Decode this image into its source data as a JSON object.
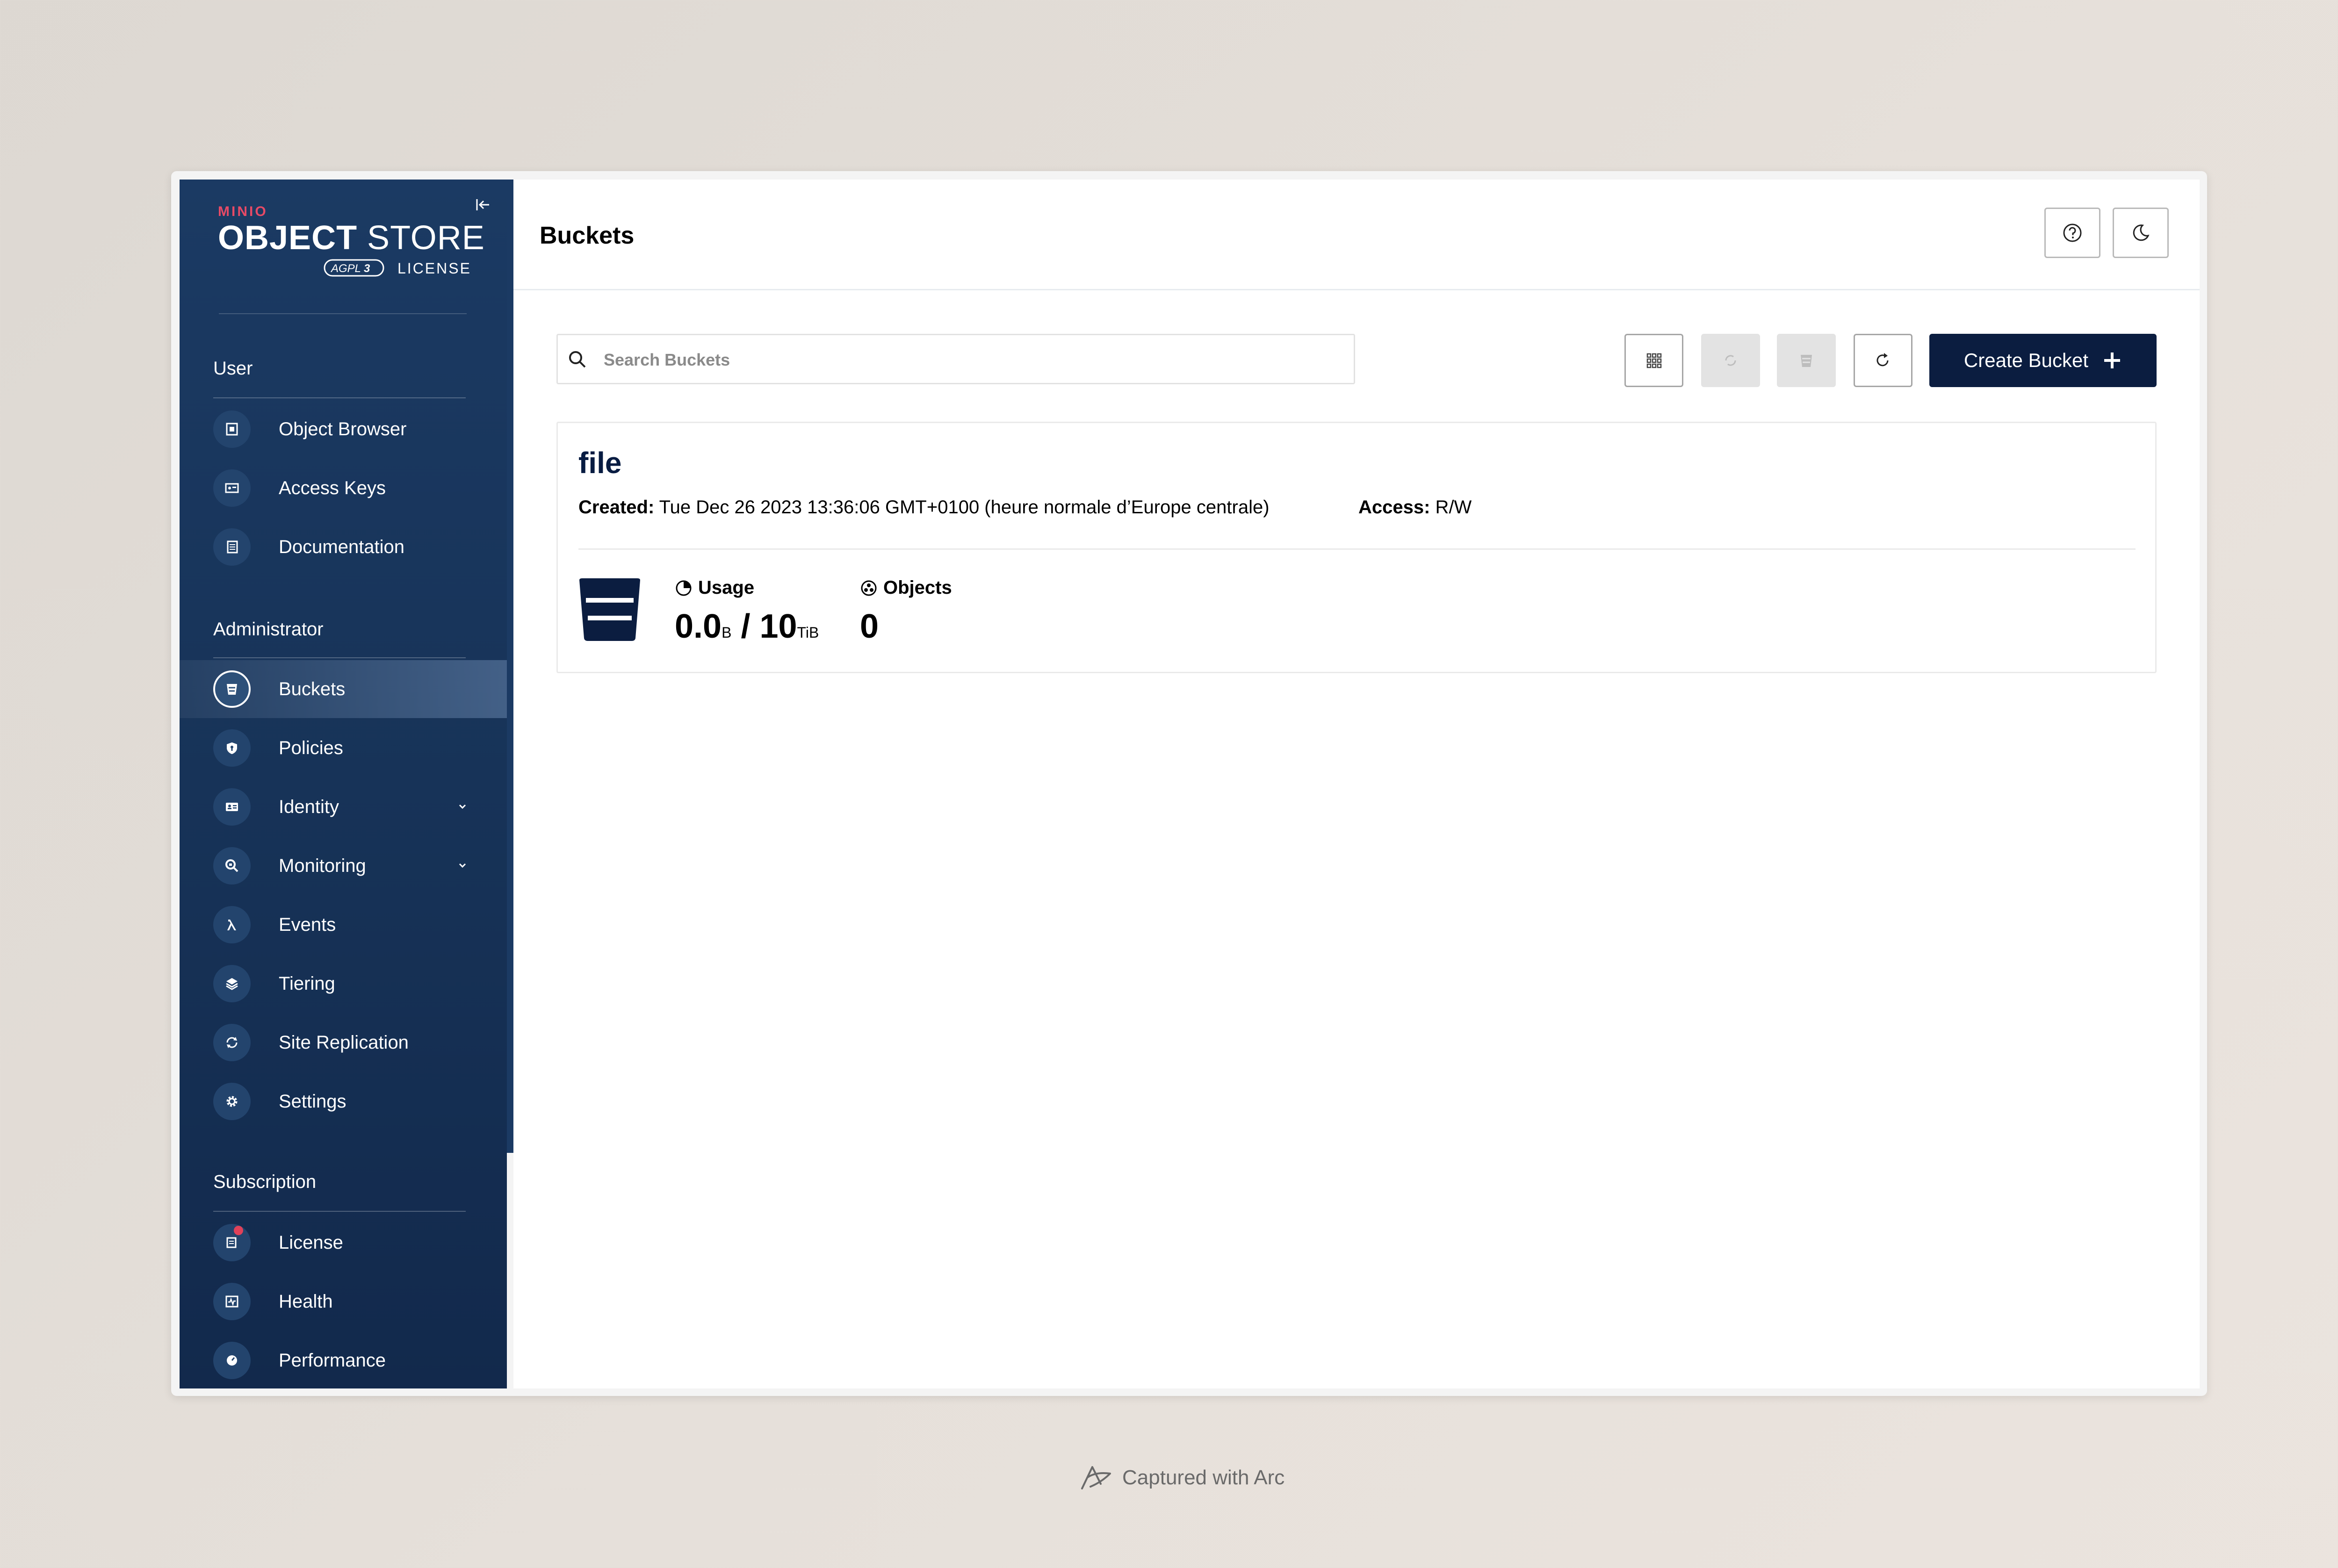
{
  "sidebar": {
    "logo": {
      "brand": "MINIO",
      "product_bold": "OBJECT",
      "product_light": " STORE",
      "badge": "AGPLv3",
      "license": "LICENSE"
    },
    "sections": [
      {
        "title": "User"
      },
      {
        "title": "Administrator"
      },
      {
        "title": "Subscription"
      }
    ],
    "items": [
      {
        "label": "Object Browser"
      },
      {
        "label": "Access Keys"
      },
      {
        "label": "Documentation"
      },
      {
        "label": "Buckets"
      },
      {
        "label": "Policies"
      },
      {
        "label": "Identity"
      },
      {
        "label": "Monitoring"
      },
      {
        "label": "Events"
      },
      {
        "label": "Tiering"
      },
      {
        "label": "Site Replication"
      },
      {
        "label": "Settings"
      },
      {
        "label": "License"
      },
      {
        "label": "Health"
      },
      {
        "label": "Performance"
      }
    ],
    "active_item": "Buckets"
  },
  "header": {
    "title": "Buckets"
  },
  "toolbar": {
    "search_placeholder": "Search Buckets",
    "create_label": "Create Bucket"
  },
  "bucket": {
    "name": "file",
    "created_label": "Created:",
    "created_value": " Tue Dec 26 2023 13:36:06 GMT+0100 (heure normale d’Europe centrale)",
    "access_label": "Access:",
    "access_value": " R/W",
    "usage_label": "Usage",
    "usage_used": "0.0",
    "usage_used_unit": "B",
    "usage_sep": " / ",
    "usage_total": "10",
    "usage_total_unit": "TiB",
    "objects_label": "Objects",
    "objects_value": "0"
  },
  "footer": {
    "text": "Captured with Arc"
  },
  "colors": {
    "sidebar": "#173358",
    "accent": "#0b1d40",
    "badge": "#e04159"
  }
}
